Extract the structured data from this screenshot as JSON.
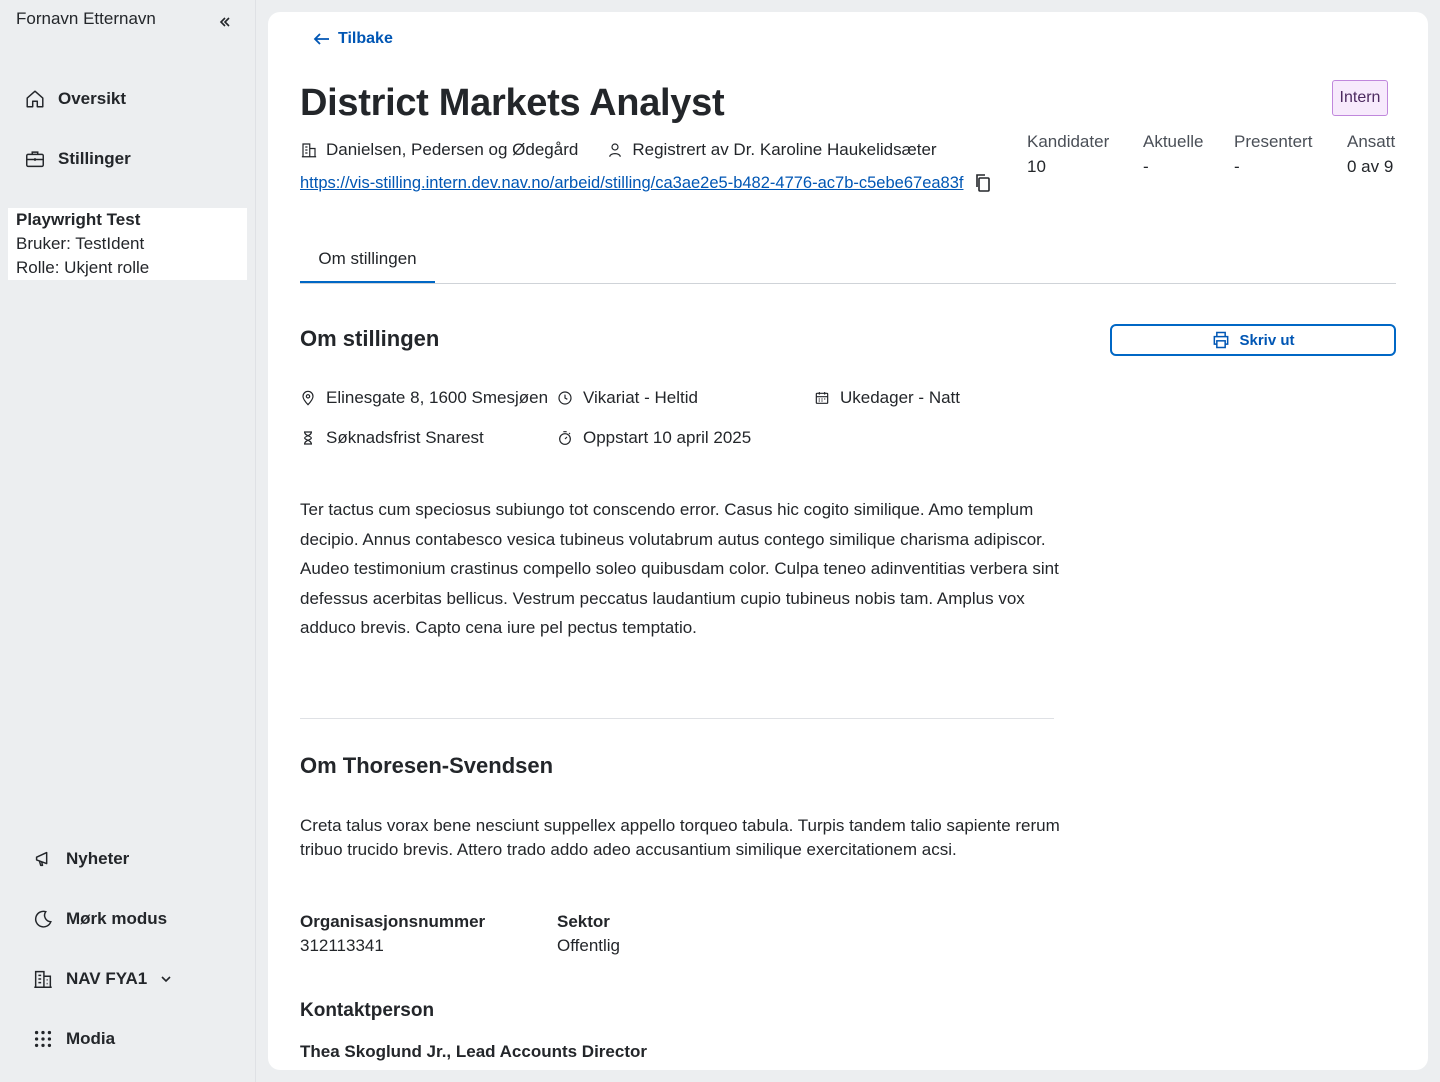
{
  "sidebar": {
    "user_name": "Fornavn Etternavn",
    "nav": [
      {
        "label": "Oversikt",
        "icon": "house-icon"
      },
      {
        "label": "Stillinger",
        "icon": "briefcase-icon"
      }
    ],
    "test_user": {
      "name": "Playwright Test",
      "bruker": "Bruker: TestIdent",
      "rolle": "Rolle: Ukjent rolle"
    },
    "bottom": [
      {
        "label": "Nyheter",
        "icon": "megaphone-icon"
      },
      {
        "label": "Mørk modus",
        "icon": "moon-icon"
      },
      {
        "label": "NAV FYA1",
        "icon": "office-building-icon"
      },
      {
        "label": "Modia",
        "icon": "grid-dots-icon"
      }
    ]
  },
  "main": {
    "back_label": "Tilbake",
    "title": "District Markets Analyst",
    "tag": "Intern",
    "employer": "Danielsen, Pedersen og Ødegård",
    "registered_by": "Registrert av Dr. Karoline Haukelidsæter",
    "url": "https://vis-stilling.intern.dev.nav.no/arbeid/stilling/ca3ae2e5-b482-4776-ac7b-c5ebe67ea83f",
    "stats": [
      {
        "label": "Kandidater",
        "value": "10"
      },
      {
        "label": "Aktuelle",
        "value": "-"
      },
      {
        "label": "Presentert",
        "value": "-"
      },
      {
        "label": "Ansatt",
        "value": "0 av 9"
      }
    ],
    "tab": "Om stillingen",
    "section_title": "Om stillingen",
    "print_label": "Skriv ut",
    "details": {
      "address": "Elinesgate 8, 1600 Smesjøen",
      "engagement": "Vikariat - Heltid",
      "workdays": "Ukedager - Natt",
      "deadline": "Søknadsfrist Snarest",
      "start": "Oppstart 10 april 2025"
    },
    "description": "Ter tactus cum speciosus subiungo tot conscendo error. Casus hic cogito similique. Amo templum decipio. Annus contabesco vesica tubineus volutabrum autus contego similique charisma adipiscor. Audeo testimonium crastinus compello soleo quibusdam color. Culpa teneo adinventitias verbera sint defessus acerbitas bellicus. Vestrum peccatus laudantium cupio tubineus nobis tam. Amplus vox adduco brevis. Capto cena iure pel pectus temptatio.",
    "employer_section_title": "Om Thoresen-Svendsen",
    "employer_description": "Creta talus vorax bene nesciunt suppellex appello torqueo tabula. Turpis tandem talio sapiente rerum tribuo trucido brevis. Attero trado addo adeo accusantium similique exercitationem acsi.",
    "org_number_label": "Organisasjonsnummer",
    "org_number": "312113341",
    "sector_label": "Sektor",
    "sector": "Offentlig",
    "contact_title": "Kontaktperson",
    "contact_name": "Thea Skoglund Jr., Lead Accounts Director"
  },
  "colors": {
    "accent": "#0067c5",
    "link": "#0056b4",
    "tag_border": "#c087dc",
    "tag_bg": "#f7eafc"
  }
}
